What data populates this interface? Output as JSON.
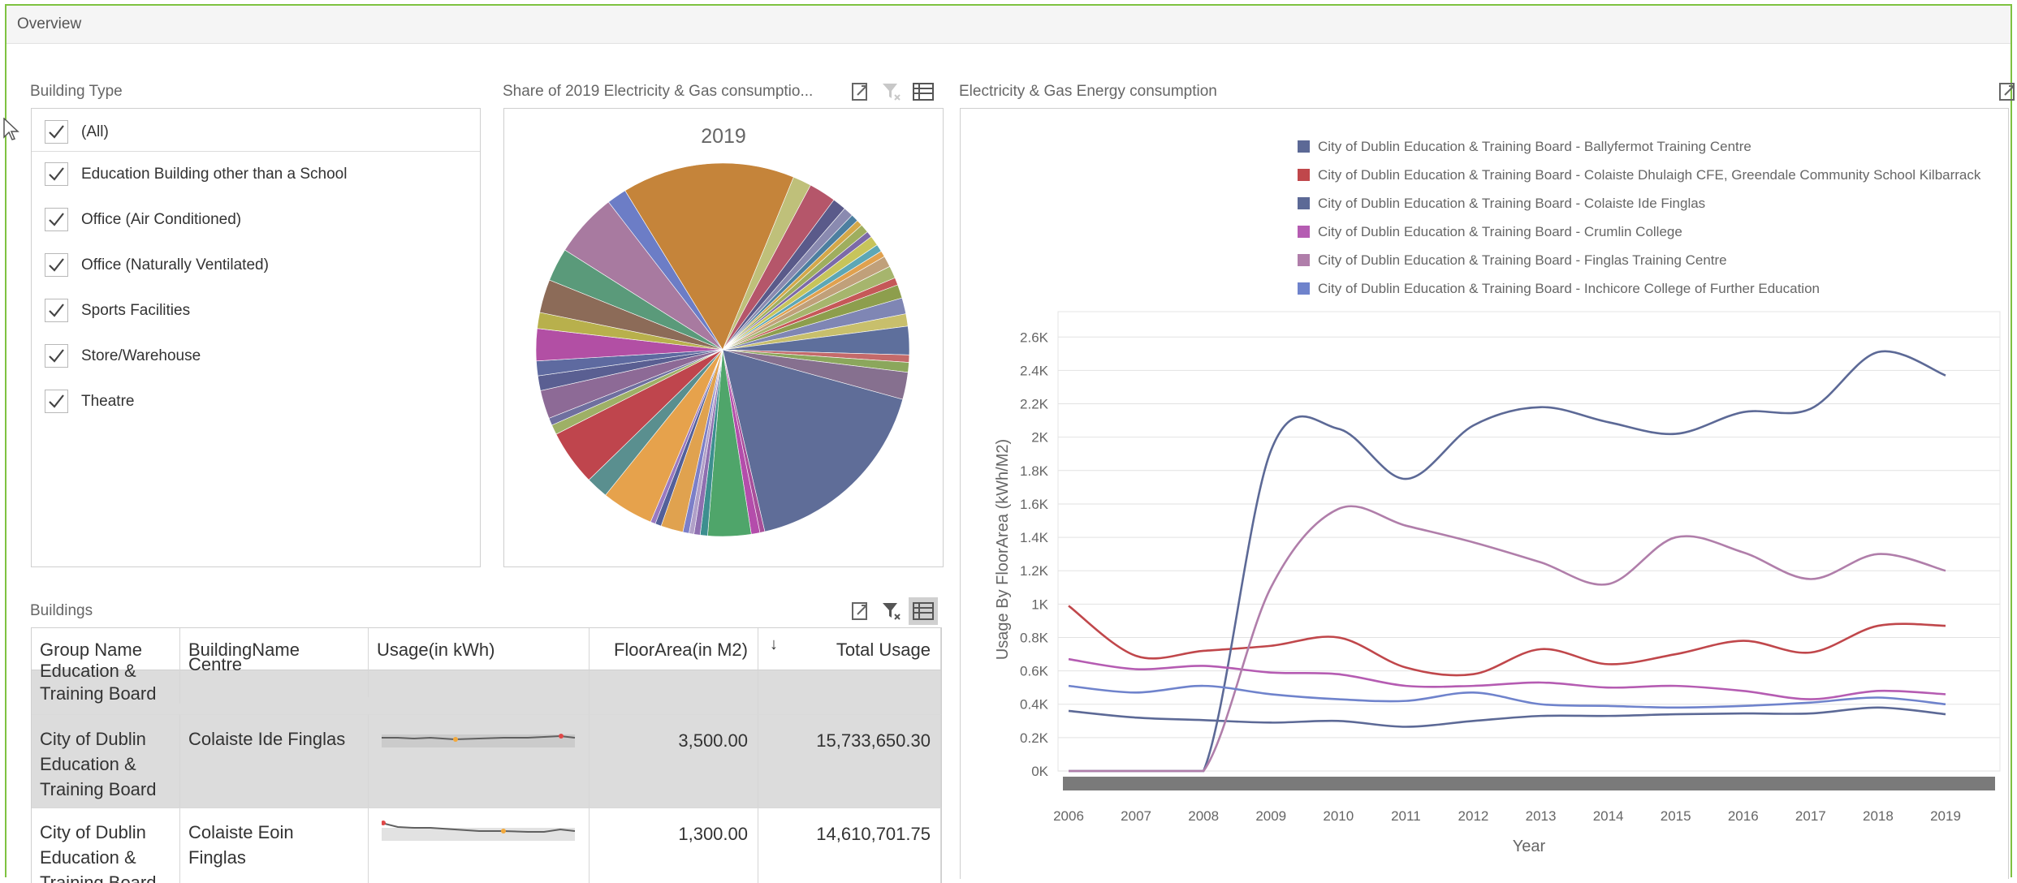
{
  "window": {
    "title": "Overview"
  },
  "building_type": {
    "caption": "Building Type",
    "items": [
      {
        "label": "(All)",
        "checked": true
      },
      {
        "label": "Education Building other than a School",
        "checked": true
      },
      {
        "label": "Office (Air Conditioned)",
        "checked": true
      },
      {
        "label": "Office (Naturally Ventilated)",
        "checked": true
      },
      {
        "label": "Sports Facilities",
        "checked": true
      },
      {
        "label": "Store/Warehouse",
        "checked": true
      },
      {
        "label": "Theatre",
        "checked": true
      }
    ]
  },
  "pie_panel": {
    "caption": "Share of 2019 Electricity & Gas consumptio...",
    "chart_title": "2019",
    "icons": [
      "export-icon",
      "clear-filter-icon",
      "multi-select-icon"
    ]
  },
  "line_panel": {
    "caption": "Electricity & Gas Energy consumption",
    "icons": [
      "export-icon"
    ]
  },
  "buildings": {
    "caption": "Buildings",
    "icons": [
      "export-icon",
      "clear-filter-icon",
      "multi-select-icon"
    ],
    "columns": [
      "Group Name",
      "BuildingName",
      "Usage(in kWh)",
      "FloorArea(in M2)",
      "Total Usage"
    ],
    "sort_indicator": "↓",
    "rows": [
      {
        "group": "Education & Training Board",
        "group_lines": [
          "Education &",
          "Training Board"
        ],
        "building_lines": [
          "Centre"
        ],
        "floor_area": "",
        "total": "",
        "selected": true,
        "partial": true
      },
      {
        "group": "City of Dublin Education & Training Board",
        "group_lines": [
          "City of Dublin",
          "Education &",
          "Training Board"
        ],
        "building_lines": [
          "Colaiste Ide Finglas"
        ],
        "floor_area": "3,500.00",
        "total": "15,733,650.30",
        "selected": true
      },
      {
        "group": "City of Dublin Education & Training Board",
        "group_lines": [
          "City of Dublin",
          "Education &",
          "Training Board"
        ],
        "building_lines": [
          "Colaiste Eoin",
          "Finglas"
        ],
        "floor_area": "1,300.00",
        "total": "14,610,701.75",
        "selected": false
      }
    ]
  },
  "colors": {
    "frame": "#7fc241",
    "ballyfermot": "#5c6996",
    "colaiste_dhulaigh": "#c0474b",
    "colaiste_ide": "#5c6996",
    "crumlin": "#b55cb2",
    "finglas_training": "#b07eaa",
    "inchicore": "#6f83cc"
  },
  "chart_data": {
    "type": "line",
    "xlabel": "Year",
    "ylabel": "Usage By FloorArea (kWh/M2)",
    "x": [
      2006,
      2007,
      2008,
      2009,
      2010,
      2011,
      2012,
      2013,
      2014,
      2015,
      2016,
      2017,
      2018,
      2019
    ],
    "ylim": [
      0,
      2650
    ],
    "y_ticks": [
      "0K",
      "0.2K",
      "0.4K",
      "0.6K",
      "0.8K",
      "1K",
      "1.2K",
      "1.4K",
      "1.6K",
      "1.8K",
      "2K",
      "2.2K",
      "2.4K",
      "2.6K"
    ],
    "legend_placement": "top",
    "series": [
      {
        "name": "City of Dublin Education & Training Board - Ballyfermot Training Centre",
        "color": "#5c6996",
        "values": [
          360,
          320,
          305,
          290,
          300,
          265,
          300,
          330,
          330,
          340,
          345,
          345,
          380,
          340
        ]
      },
      {
        "name": "City of Dublin Education & Training Board - Colaiste Dhulaigh CFE, Greendale Community School Kilbarrack",
        "color": "#c0474b",
        "values": [
          990,
          690,
          720,
          750,
          800,
          620,
          580,
          730,
          640,
          700,
          780,
          710,
          870,
          870
        ]
      },
      {
        "name": "City of Dublin Education & Training Board - Colaiste Ide Finglas",
        "color": "#5c6996",
        "values": [
          0,
          0,
          0,
          1920,
          2050,
          1750,
          2070,
          2180,
          2090,
          2020,
          2150,
          2170,
          2510,
          2370
        ]
      },
      {
        "name": "City of Dublin Education & Training Board - Crumlin College",
        "color": "#b55cb2",
        "values": [
          670,
          610,
          630,
          590,
          580,
          510,
          510,
          530,
          500,
          510,
          480,
          430,
          480,
          460
        ]
      },
      {
        "name": "City of Dublin Education & Training Board - Finglas Training Centre",
        "color": "#b07eaa",
        "values": [
          0,
          0,
          0,
          1100,
          1570,
          1470,
          1370,
          1250,
          1120,
          1400,
          1310,
          1150,
          1300,
          1200
        ]
      },
      {
        "name": "City of Dublin Education & Training Board - Inchicore College of Further Education",
        "color": "#6f83cc",
        "values": [
          510,
          470,
          510,
          460,
          430,
          420,
          470,
          400,
          390,
          380,
          390,
          410,
          440,
          400
        ]
      }
    ]
  }
}
